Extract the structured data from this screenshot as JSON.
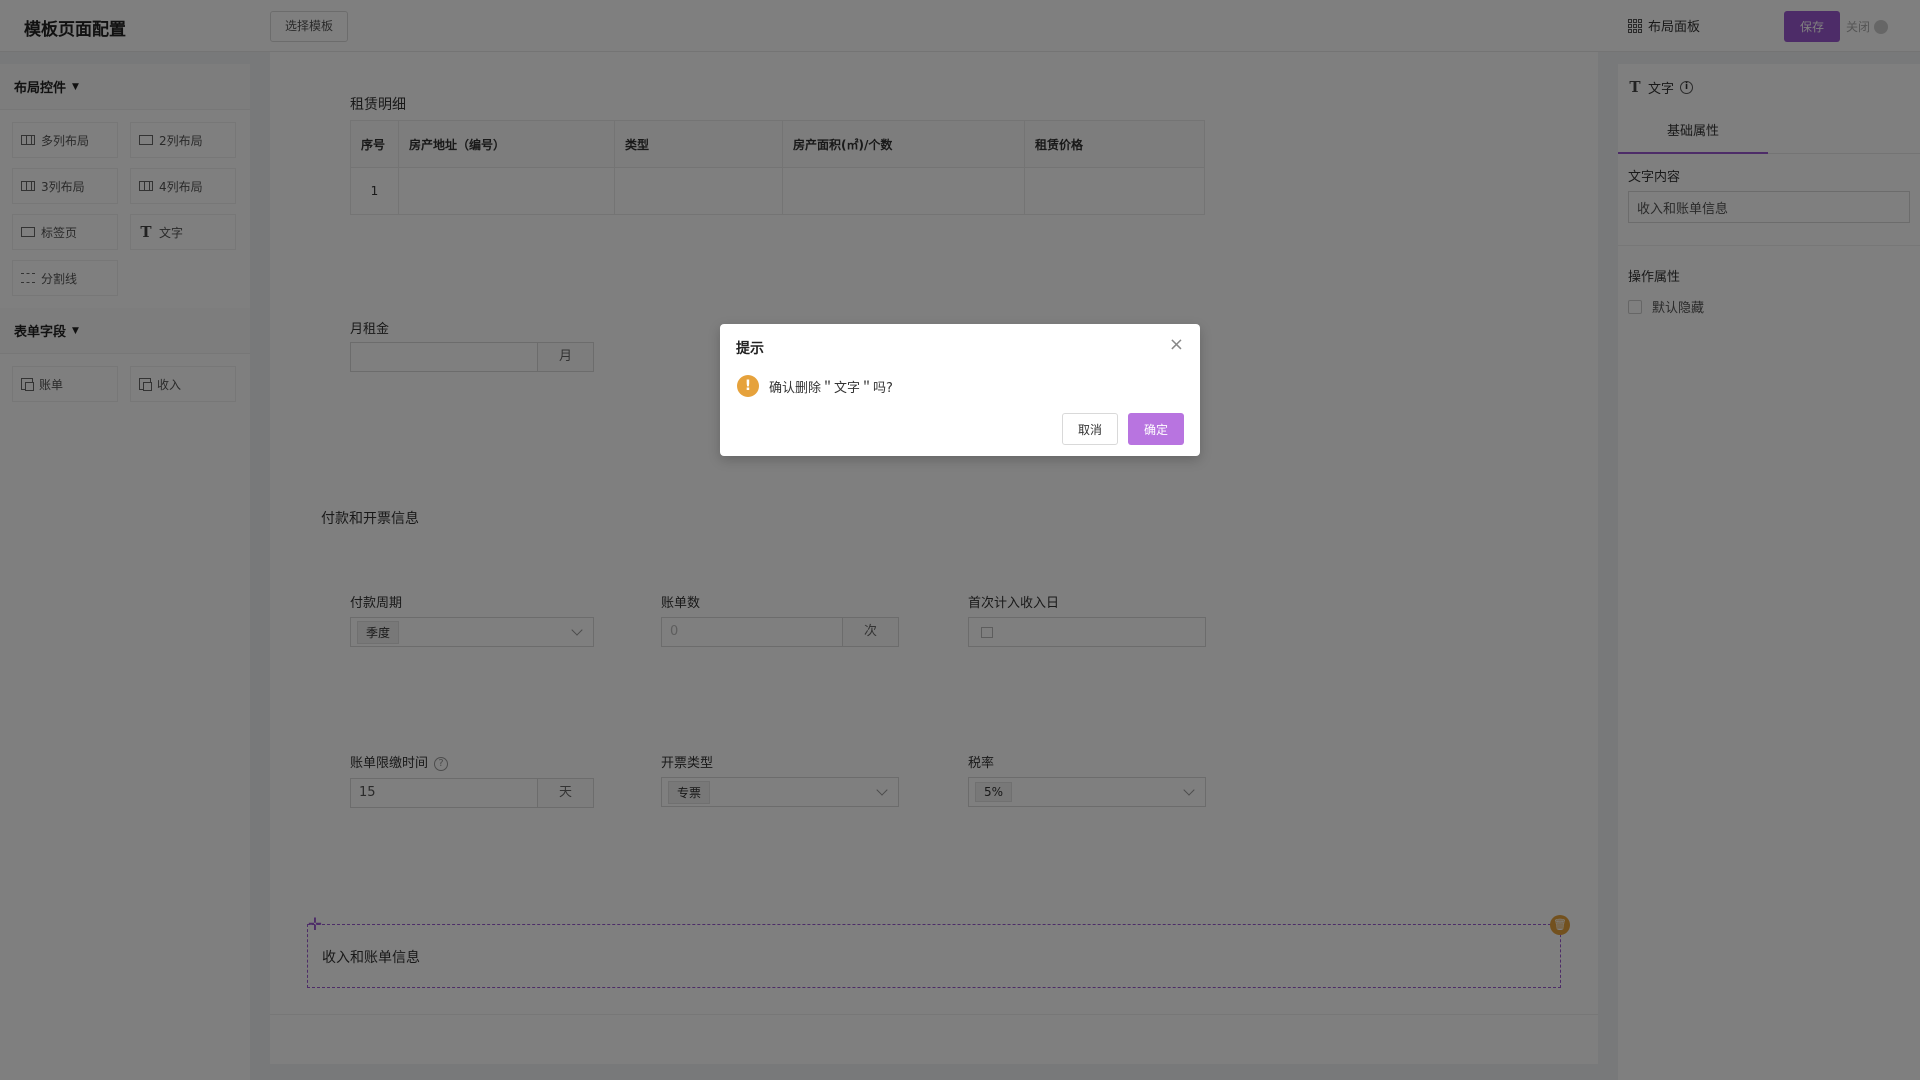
{
  "header": {
    "title": "模板页面配置",
    "select_template_label": "选择模板",
    "layout_panel_label": "布局面板",
    "save_label": "保存",
    "close_label": "关闭"
  },
  "left_sidebar": {
    "layout_section": {
      "title": "布局控件",
      "items": [
        "多列布局",
        "2列布局",
        "3列布局",
        "4列布局",
        "标签页",
        "文字",
        "分割线"
      ]
    },
    "form_section": {
      "title": "表单字段",
      "items": [
        "账单",
        "收入"
      ]
    }
  },
  "canvas": {
    "rental_section_title": "租赁明细",
    "table": {
      "headers": [
        "序号",
        "房产地址（编号）",
        "类型",
        "房产面积(㎡)/个数",
        "租赁价格"
      ],
      "rows": [
        [
          "1",
          "",
          "",
          "",
          ""
        ]
      ]
    },
    "monthly_rent": {
      "label": "月租金",
      "value": "",
      "unit": "月"
    },
    "payment_section_title": "付款和开票信息",
    "payment_cycle": {
      "label": "付款周期",
      "value": "季度"
    },
    "bill_count": {
      "label": "账单数",
      "placeholder": "0",
      "unit": "次"
    },
    "first_income_date": {
      "label": "首次计入收入日",
      "value": ""
    },
    "bill_due": {
      "label": "账单限缴时间",
      "help": "?",
      "value": "15",
      "unit": "天"
    },
    "invoice_type": {
      "label": "开票类型",
      "value": "专票"
    },
    "tax_rate": {
      "label": "税率",
      "value": "5%"
    },
    "text_block": {
      "text": "收入和账单信息"
    }
  },
  "right_panel": {
    "component_name": "文字",
    "tab_basic": "基础属性",
    "text_content_label": "文字内容",
    "text_content_value": "收入和账单信息",
    "operation_props_label": "操作属性",
    "default_hidden_label": "默认隐藏",
    "default_hidden_checked": false
  },
  "dialog": {
    "title": "提示",
    "message": "确认删除＂文字＂吗?",
    "cancel_label": "取消",
    "ok_label": "确定"
  },
  "colors": {
    "accent": "#9b59d0",
    "warning": "#e6a23c"
  }
}
